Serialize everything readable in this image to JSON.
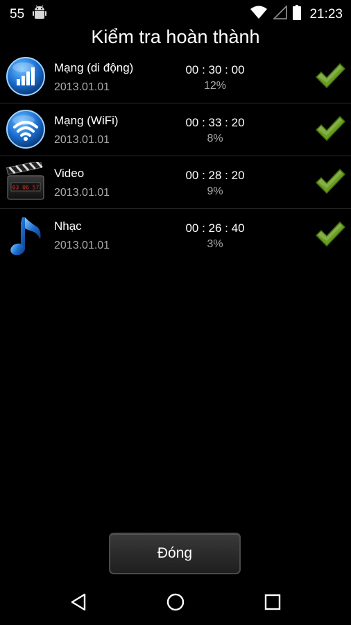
{
  "status_bar": {
    "notification_count": "55",
    "time": "21:23",
    "icons": [
      "android-icon",
      "wifi-icon",
      "cell-signal-icon",
      "battery-icon"
    ]
  },
  "title": "Kiểm tra hoàn thành",
  "results": [
    {
      "icon": "mobile-network-icon",
      "name": "Mạng (di động)",
      "date": "2013.01.01",
      "time": "00 : 30 : 00",
      "percent": "12%",
      "status": "check-icon"
    },
    {
      "icon": "wifi-globe-icon",
      "name": "Mạng (WiFi)",
      "date": "2013.01.01",
      "time": "00 : 33 : 20",
      "percent": "8%",
      "status": "check-icon"
    },
    {
      "icon": "video-clapper-icon",
      "name": "Video",
      "date": "2013.01.01",
      "time": "00 : 28 : 20",
      "percent": "9%",
      "status": "check-icon"
    },
    {
      "icon": "music-note-icon",
      "name": "Nhạc",
      "date": "2013.01.01",
      "time": "00 : 26 : 40",
      "percent": "3%",
      "status": "check-icon"
    }
  ],
  "close_button": {
    "label": "Đóng"
  },
  "nav_bar": {
    "buttons": [
      "back-icon",
      "home-icon",
      "recents-icon"
    ]
  },
  "colors": {
    "background": "#000000",
    "secondary_text": "#aaaaaa",
    "check_green": "#6a9e1f",
    "icon_blue": "#1e6fd0"
  }
}
